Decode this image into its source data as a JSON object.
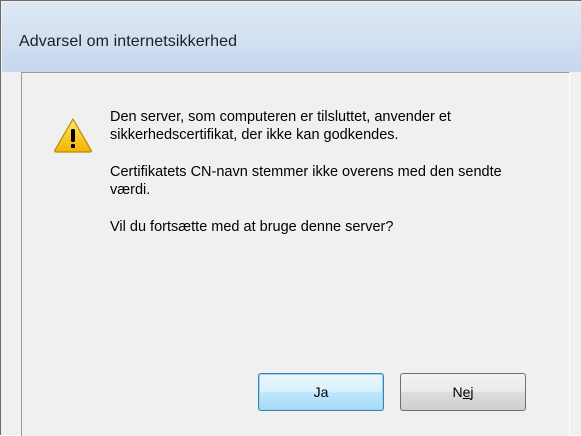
{
  "dialog": {
    "title": "Advarsel om internetsikkerhed",
    "icon": "warning-icon"
  },
  "message": {
    "line1": "Den server, som computeren er tilsluttet, anvender et sikkerhedscertifikat, der ikke kan godkendes.",
    "line2": "Certifikatets CN-navn stemmer ikke overens med den sendte\nværdi.",
    "line3": "Vil du fortsætte med at bruge denne server?"
  },
  "buttons": {
    "yes_label": "Ja",
    "no_prefix": "N",
    "no_mnemonic": "e",
    "no_suffix": "j"
  },
  "colors": {
    "title_gradient_top": "#dfe9f5",
    "title_gradient_bottom": "#c6d8ee",
    "warning_yellow": "#f5c400",
    "default_button_border": "#3c7fb1"
  }
}
